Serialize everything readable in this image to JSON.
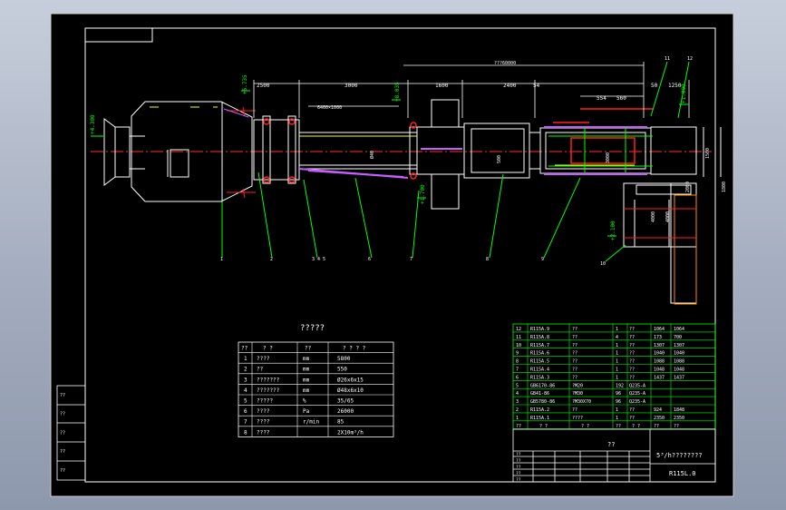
{
  "sheet": {
    "spec_title": "?????",
    "spec_headers": [
      "??",
      "? ?",
      "??",
      "? ? ? ?"
    ],
    "spec_rows": [
      {
        "no": "1",
        "name": "????",
        "unit": "mm",
        "value": "5800"
      },
      {
        "no": "2",
        "name": "??",
        "unit": "mm",
        "value": "550"
      },
      {
        "no": "3",
        "name": "???????",
        "unit": "mm",
        "value": "Ø26x6x15"
      },
      {
        "no": "4",
        "name": "???????",
        "unit": "mm",
        "value": "Ø48x6x10"
      },
      {
        "no": "5",
        "name": "?????",
        "unit": "%",
        "value": "35/65"
      },
      {
        "no": "6",
        "name": "????",
        "unit": "Pa",
        "value": "26000"
      },
      {
        "no": "7",
        "name": "????",
        "unit": "r/min",
        "value": "85"
      },
      {
        "no": "8",
        "name": "????",
        "unit": "",
        "value": "2X10m³/h"
      }
    ],
    "bom_rows": [
      {
        "no": "12",
        "code": "R115A.9",
        "name": "??",
        "qty": "1",
        "mat": "??",
        "w1": "1064",
        "w2": "1064"
      },
      {
        "no": "11",
        "code": "R115A.8",
        "name": "??",
        "qty": "4",
        "mat": "??",
        "w1": "173",
        "w2": "700"
      },
      {
        "no": "10",
        "code": "R115A.7",
        "name": "??",
        "qty": "1",
        "mat": "??",
        "w1": "1307",
        "w2": "1307"
      },
      {
        "no": "9",
        "code": "R115A.6",
        "name": "??",
        "qty": "1",
        "mat": "??",
        "w1": "1040",
        "w2": "1040"
      },
      {
        "no": "8",
        "code": "R115A.5",
        "name": "??",
        "qty": "1",
        "mat": "??",
        "w1": "1088",
        "w2": "1088"
      },
      {
        "no": "7",
        "code": "R115A.4",
        "name": "??",
        "qty": "1",
        "mat": "??",
        "w1": "1048",
        "w2": "1048"
      },
      {
        "no": "6",
        "code": "R115A.3",
        "name": "??",
        "qty": "1",
        "mat": "??",
        "w1": "1437",
        "w2": "1437"
      },
      {
        "no": "5",
        "code": "GB6170-86",
        "name": "?M20",
        "qty": "192",
        "mat": "Q235-A",
        "w1": "",
        "w2": ""
      },
      {
        "no": "4",
        "code": "GB41-86",
        "name": "?M30",
        "qty": "96",
        "mat": "Q235-A",
        "w1": "",
        "w2": ""
      },
      {
        "no": "3",
        "code": "GB5780-86",
        "name": "?M30X70",
        "qty": "96",
        "mat": "Q235-A",
        "w1": "",
        "w2": ""
      },
      {
        "no": "2",
        "code": "R115A.2",
        "name": "??",
        "qty": "1",
        "mat": "??",
        "w1": "924",
        "w2": "1848"
      },
      {
        "no": "1",
        "code": "R115A.1",
        "name": "????",
        "qty": "1",
        "mat": "??",
        "w1": "2350",
        "w2": "2350"
      }
    ],
    "bom_header": [
      "??",
      "? ?",
      "? ?",
      "??",
      "? ?",
      "??",
      "??"
    ],
    "title_block": {
      "part_label": "??",
      "drawing_name": "5³/h????????",
      "drawing_code": "R115L.0",
      "row_labels": [
        "??",
        "??",
        "??",
        "??",
        "??"
      ]
    },
    "side_labels": [
      "??",
      "??",
      "??",
      "??",
      "??"
    ],
    "dims": {
      "d_2500a": "2500",
      "d_3000": "3000",
      "d_1600": "1600",
      "d_2400": "2400",
      "d_54": "54",
      "d_554": "554",
      "d_560": "560",
      "d_total": "???60000",
      "d_6400": "6400×1000",
      "d_50": "50",
      "d_1250": "1250",
      "e_4300": "+4.300",
      "e_5735": "+5.735",
      "e_1000": "+1.000",
      "e_8035": "+8.035",
      "e_1700": "+1.700",
      "e_2100": "+2.100",
      "v_1500": "1500",
      "v_500": "500",
      "v_3000a": "3000",
      "v_1800": "1800",
      "inner_1": "Ø40",
      "inner_2": "4000",
      "inner_3": "4000",
      "ax_1": "2000"
    },
    "leaders": [
      "1",
      "2",
      "3 4 5",
      "6",
      "7",
      "8",
      "9",
      "10",
      "11",
      "12"
    ]
  }
}
